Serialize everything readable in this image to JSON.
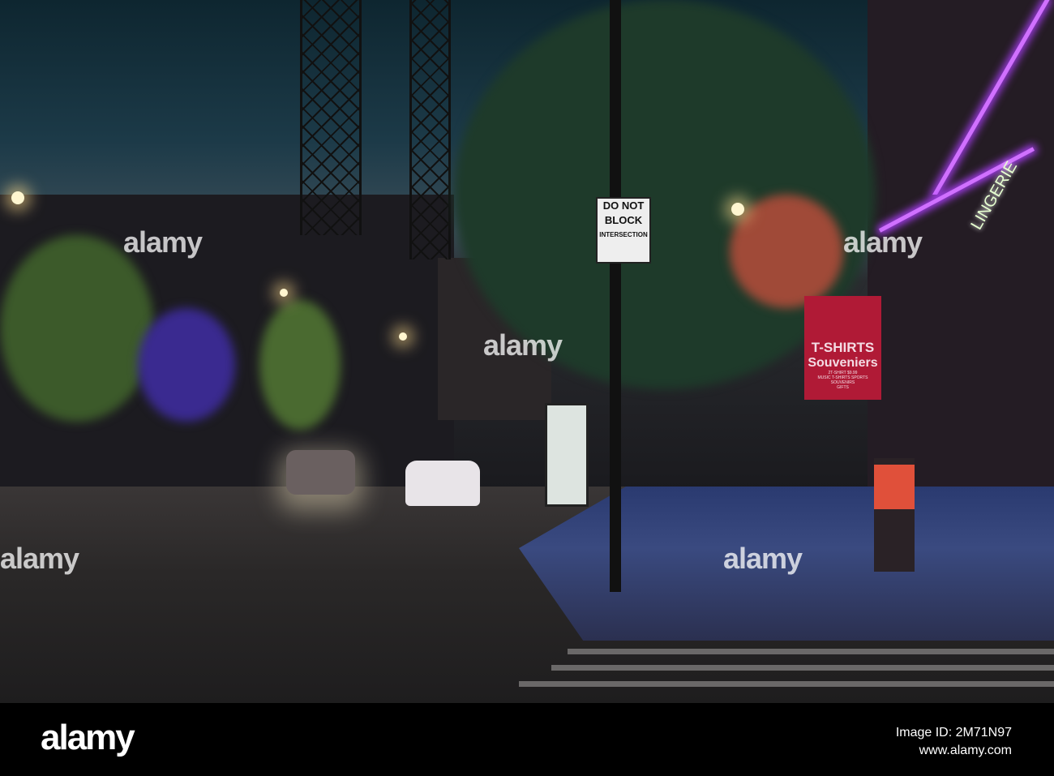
{
  "signs": {
    "do_not_block": [
      "DO NOT",
      "BLOCK",
      "INTERSECTION"
    ],
    "tshirt_title": "T-SHIRTS",
    "tshirt_subtitle": "Souveniers",
    "tshirt_lines": [
      "2T-SHIRT $9.99",
      "MUSIC T-SHIRTS SPORTS",
      "SOUVENIRS",
      "GIFTS"
    ],
    "neon_text": "LINGERIE"
  },
  "watermark": {
    "text": "alamy"
  },
  "footer": {
    "logo": "alamy",
    "image_id": "Image ID: 2M71N97",
    "url": "www.alamy.com"
  },
  "colors": {
    "sky": "#1c3a48",
    "neon": "#d070ff",
    "awning": "#b01a36"
  }
}
